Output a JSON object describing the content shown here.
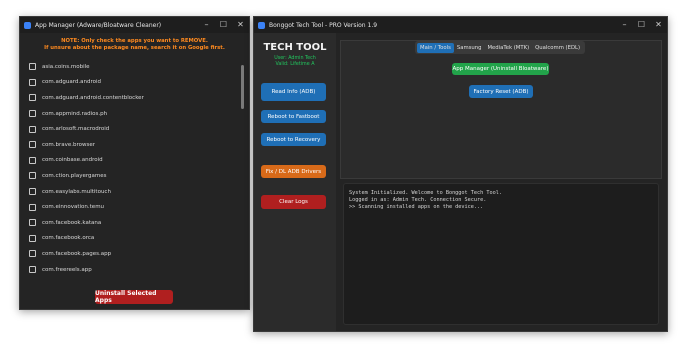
{
  "window1": {
    "title": "App Manager (Adware/Bloatware Cleaner)",
    "notice_line1": "NOTE: Only check the apps you want to REMOVE.",
    "notice_line2": "If unsure about the package name, search it on Google first.",
    "packages": [
      "asia.coins.mobile",
      "com.adguard.android",
      "com.adguard.android.contentblocker",
      "com.appmind.radios.ph",
      "com.arlosoft.macrodroid",
      "com.brave.browser",
      "com.coinbase.android",
      "com.ction.playergames",
      "com.easylabs.multitouch",
      "com.einnovation.temu",
      "com.facebook.katana",
      "com.facebook.orca",
      "com.facebook.pages.app",
      "com.freereels.app"
    ],
    "uninstall_label": "Uninstall Selected Apps"
  },
  "window2": {
    "title": "Bonggot Tech Tool - PRO Version 1.9",
    "brand": "TECH TOOL",
    "user_line1": "User: Admin Tech",
    "user_line2": "Valid: Lifetime A",
    "sidebar": {
      "read_info": "Read Info (ADB)",
      "reboot_fastboot": "Reboot to Fastboot",
      "reboot_recovery": "Reboot to Recovery",
      "fix_drivers": "Fix / DL ADB Drivers",
      "clear_logs": "Clear Logs"
    },
    "tabs": [
      "Main / Tools",
      "Samsung",
      "MediaTek (MTK)",
      "Qualcomm (EDL)"
    ],
    "main": {
      "app_manager": "App Manager (Uninstall Bloatware)",
      "factory_reset": "Factory Reset (ADB)"
    },
    "console": [
      "System Initialized. Welcome to Bonggot Tech Tool.",
      "Logged in as: Admin Tech. Connection Secure.",
      "",
      ">> Scanning installed apps on the device..."
    ]
  },
  "controls": {
    "minimize": "–",
    "maximize": "☐",
    "close": "✕"
  },
  "colors": {
    "accent_blue": "#1f6fb6",
    "danger_red": "#b01f1f",
    "warn_orange": "#d86a19",
    "ok_green": "#22a34a",
    "notice_orange": "#ff8a1f"
  }
}
